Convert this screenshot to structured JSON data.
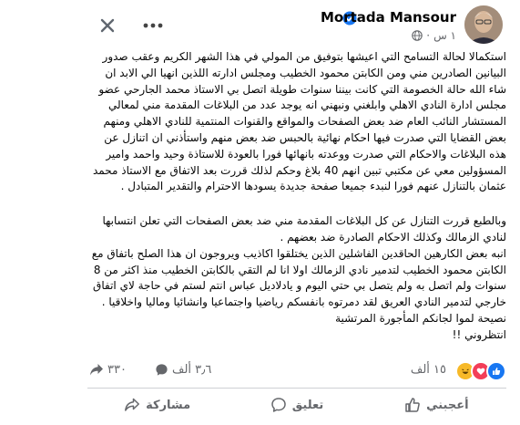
{
  "header": {
    "author_name": "Mortada Mansour",
    "time_text": "١ س",
    "more_label": "...",
    "icons": {
      "close": "close-icon",
      "more": "more-dots-icon",
      "verified": "verified-badge-icon",
      "privacy": "globe-icon"
    }
  },
  "post": {
    "paragraphs": [
      "استكمالا لحالة التسامح التي اعيشها بتوفيق من المولي في هذا الشهر الكريم وعقب صدور البيانين الصادرين مني ومن الكابتن محمود الخطيب ومجلس ادارته اللذين انهيا الي الابد ان شاء الله حالة الخصومة التي كانت بيننا سنوات طويلة اتصل بي الاستاذ محمد الجارحي عضو مجلس ادارة النادي الاهلي وابلغني ونبهني انه يوجد عدد من البلاغات المقدمة مني لمعالي المستشار النائب العام ضد بعض الصفحات والمواقع والقنوات المنتمية للنادي الاهلي ومنهم بعض القضايا التي صدرت فيها احكام نهائية بالحبس ضد بعض منهم واستأذني ان اتنازل عن هذه البلاغات والاحكام التي صدرت ووعدته بانهائها فورا بالعودة للاستاذة وحيد واحمد وامير المسؤولين معي عن مكتبي تبين انهم 40 بلاغ وحكم لذلك قررت بعد الاتفاق مع الاستاذ محمد عثمان بالتنازل عنهم فورا لنبدء جميعا صفحة جديدة يسودها الاحترام والتقدير المتبادل .",
      "وبالطبع قررت التنازل عن كل البلاغات المقدمة مني ضد بعض الصفحات التي تعلن انتسابها لنادي الزمالك وكذلك الاحكام الصادرة ضد بعضهم .\nانبه بعض الكارهين الحاقدين الفاشلين الذين يختلقوا اكاذيب ويروجون ان هذا الصلح باتفاق مع الكابتن محمود الخطيب لتدمير نادي الزمالك اولا انا لم التقي بالكابتن الخطيب منذ اكثر من 8 سنوات ولم اتصل به ولم يتصل بي حتي اليوم و يادلاديل عباس انتم لستم في حاجة لاي اتفاق خارجي لتدمير النادي العريق لقد دمرتوه بانفسكم رياضيا واجتماعيا وانشائيا وماليا واخلاقيا .\nنصيحة لموا لجانكم المأجورة المرتشية\nانتظروني !!"
    ]
  },
  "stats": {
    "reactions_count": "١٥ ألف",
    "comments_count": "٣٫٦ ألف",
    "shares_count": "٣٣٠"
  },
  "actions": {
    "like_label": "أعجبني",
    "comment_label": "تعليق",
    "share_label": "مشاركة"
  }
}
